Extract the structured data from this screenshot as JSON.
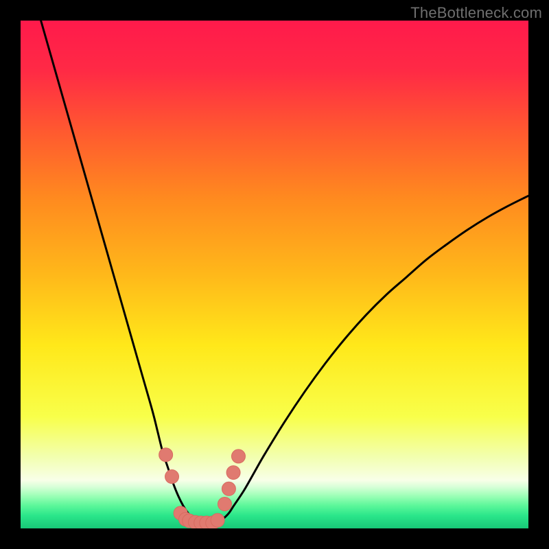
{
  "watermark": "TheBottleneck.com",
  "colors": {
    "background": "#000000",
    "curve": "#000000",
    "marker_fill": "#e07a70",
    "marker_stroke": "#d86b60",
    "watermark_text": "#6f6f6f",
    "gradient_stops": [
      {
        "offset": 0.0,
        "color": "#ff1a4b"
      },
      {
        "offset": 0.1,
        "color": "#ff2a45"
      },
      {
        "offset": 0.22,
        "color": "#ff5a2f"
      },
      {
        "offset": 0.35,
        "color": "#ff8a1f"
      },
      {
        "offset": 0.5,
        "color": "#ffb81a"
      },
      {
        "offset": 0.64,
        "color": "#ffe81a"
      },
      {
        "offset": 0.78,
        "color": "#f8ff4a"
      },
      {
        "offset": 0.86,
        "color": "#f2ffb0"
      },
      {
        "offset": 0.905,
        "color": "#f8ffe8"
      },
      {
        "offset": 0.918,
        "color": "#d8ffd8"
      },
      {
        "offset": 0.935,
        "color": "#a0ffb8"
      },
      {
        "offset": 0.955,
        "color": "#5cf79a"
      },
      {
        "offset": 0.975,
        "color": "#2ae68a"
      },
      {
        "offset": 1.0,
        "color": "#18c878"
      }
    ]
  },
  "chart_data": {
    "type": "line",
    "title": "",
    "xlabel": "",
    "ylabel": "",
    "xlim": [
      0,
      100
    ],
    "ylim": [
      0,
      100
    ],
    "grid": false,
    "legend": false,
    "series": [
      {
        "name": "left-curve",
        "x": [
          4,
          6,
          8,
          10,
          12,
          14,
          16,
          18,
          20,
          22,
          24,
          26,
          27,
          28,
          29,
          30,
          31,
          32,
          33,
          34,
          35,
          36
        ],
        "values": [
          100,
          93,
          86,
          79,
          72,
          65,
          58,
          51,
          44,
          37,
          30,
          23,
          19,
          15,
          12,
          9,
          6.5,
          4.5,
          3,
          2,
          1.3,
          1
        ]
      },
      {
        "name": "right-curve",
        "x": [
          38,
          39,
          40,
          41,
          42,
          44,
          46,
          48,
          52,
          56,
          60,
          64,
          68,
          72,
          76,
          80,
          84,
          88,
          92,
          96,
          100
        ],
        "values": [
          1,
          1.3,
          2,
          3,
          4.5,
          7.5,
          11,
          14.5,
          21,
          27,
          32.5,
          37.5,
          42,
          46,
          49.5,
          53,
          56,
          58.8,
          61.3,
          63.5,
          65.5
        ]
      }
    ],
    "markers": [
      {
        "x": 28.6,
        "y": 14.5
      },
      {
        "x": 29.8,
        "y": 10.2
      },
      {
        "x": 31.5,
        "y": 3.0
      },
      {
        "x": 32.5,
        "y": 1.8
      },
      {
        "x": 33.2,
        "y": 1.5
      },
      {
        "x": 34.4,
        "y": 1.2
      },
      {
        "x": 35.5,
        "y": 1.1
      },
      {
        "x": 36.6,
        "y": 1.1
      },
      {
        "x": 37.8,
        "y": 1.1
      },
      {
        "x": 38.8,
        "y": 1.6
      },
      {
        "x": 40.2,
        "y": 4.8
      },
      {
        "x": 41.0,
        "y": 7.8
      },
      {
        "x": 41.9,
        "y": 11.0
      },
      {
        "x": 42.9,
        "y": 14.2
      }
    ],
    "marker_radius_px": 10
  }
}
